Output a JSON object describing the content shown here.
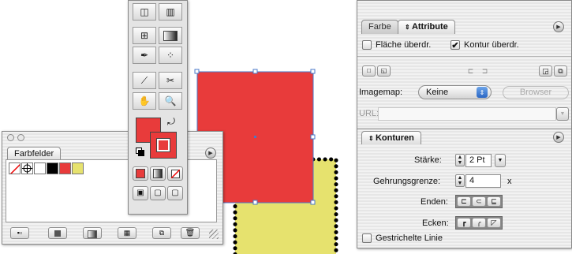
{
  "colors": {
    "red": "#e83b3b",
    "yellow": "#e6e26e",
    "selection": "#4a78c8",
    "accent_blue": "#3a73d6"
  },
  "swatches_panel": {
    "tab_label": "Farbfelder",
    "swatches": [
      {
        "name": "none",
        "color": "none"
      },
      {
        "name": "registration",
        "color": "registration"
      },
      {
        "name": "white",
        "color": "#ffffff"
      },
      {
        "name": "black",
        "color": "#000000"
      },
      {
        "name": "red",
        "color": "#e83b3b"
      },
      {
        "name": "yellow",
        "color": "#e6e26e"
      }
    ],
    "footer_icons": [
      "swatch-kind-icon",
      "show-color-swatches-icon",
      "show-gradient-swatches-icon",
      "show-pattern-swatches-icon",
      "new-swatch-icon",
      "trash-icon"
    ]
  },
  "toolbox": {
    "tools": [
      "artboard-icon",
      "graph-icon",
      "mesh-icon",
      "gradient-icon",
      "eyedropper-icon",
      "live-paint-icon",
      "knife-icon",
      "scissors-icon",
      "hand-icon",
      "zoom-icon"
    ],
    "fill_color": "#e83b3b",
    "stroke_color": "#e83b3b"
  },
  "attribute_panel": {
    "tabs": [
      "Farbe",
      "Attribute"
    ],
    "active_tab": "Attribute",
    "overprint_fill_label": "Fläche überdr.",
    "overprint_fill_checked": false,
    "overprint_stroke_label": "Kontur überdr.",
    "overprint_stroke_checked": true,
    "imagemap_label": "Imagemap:",
    "imagemap_value": "Keine",
    "browser_button": "Browser",
    "url_label": "URL:",
    "url_value": ""
  },
  "stroke_panel": {
    "tab_label": "Konturen",
    "weight_label": "Stärke:",
    "weight_value": "2 Pt",
    "miter_label": "Gehrungsgrenze:",
    "miter_value": "4",
    "miter_unit": "x",
    "caps_label": "Enden:",
    "joins_label": "Ecken:",
    "dashed_label": "Gestrichelte Linie",
    "dashed_checked": false
  }
}
